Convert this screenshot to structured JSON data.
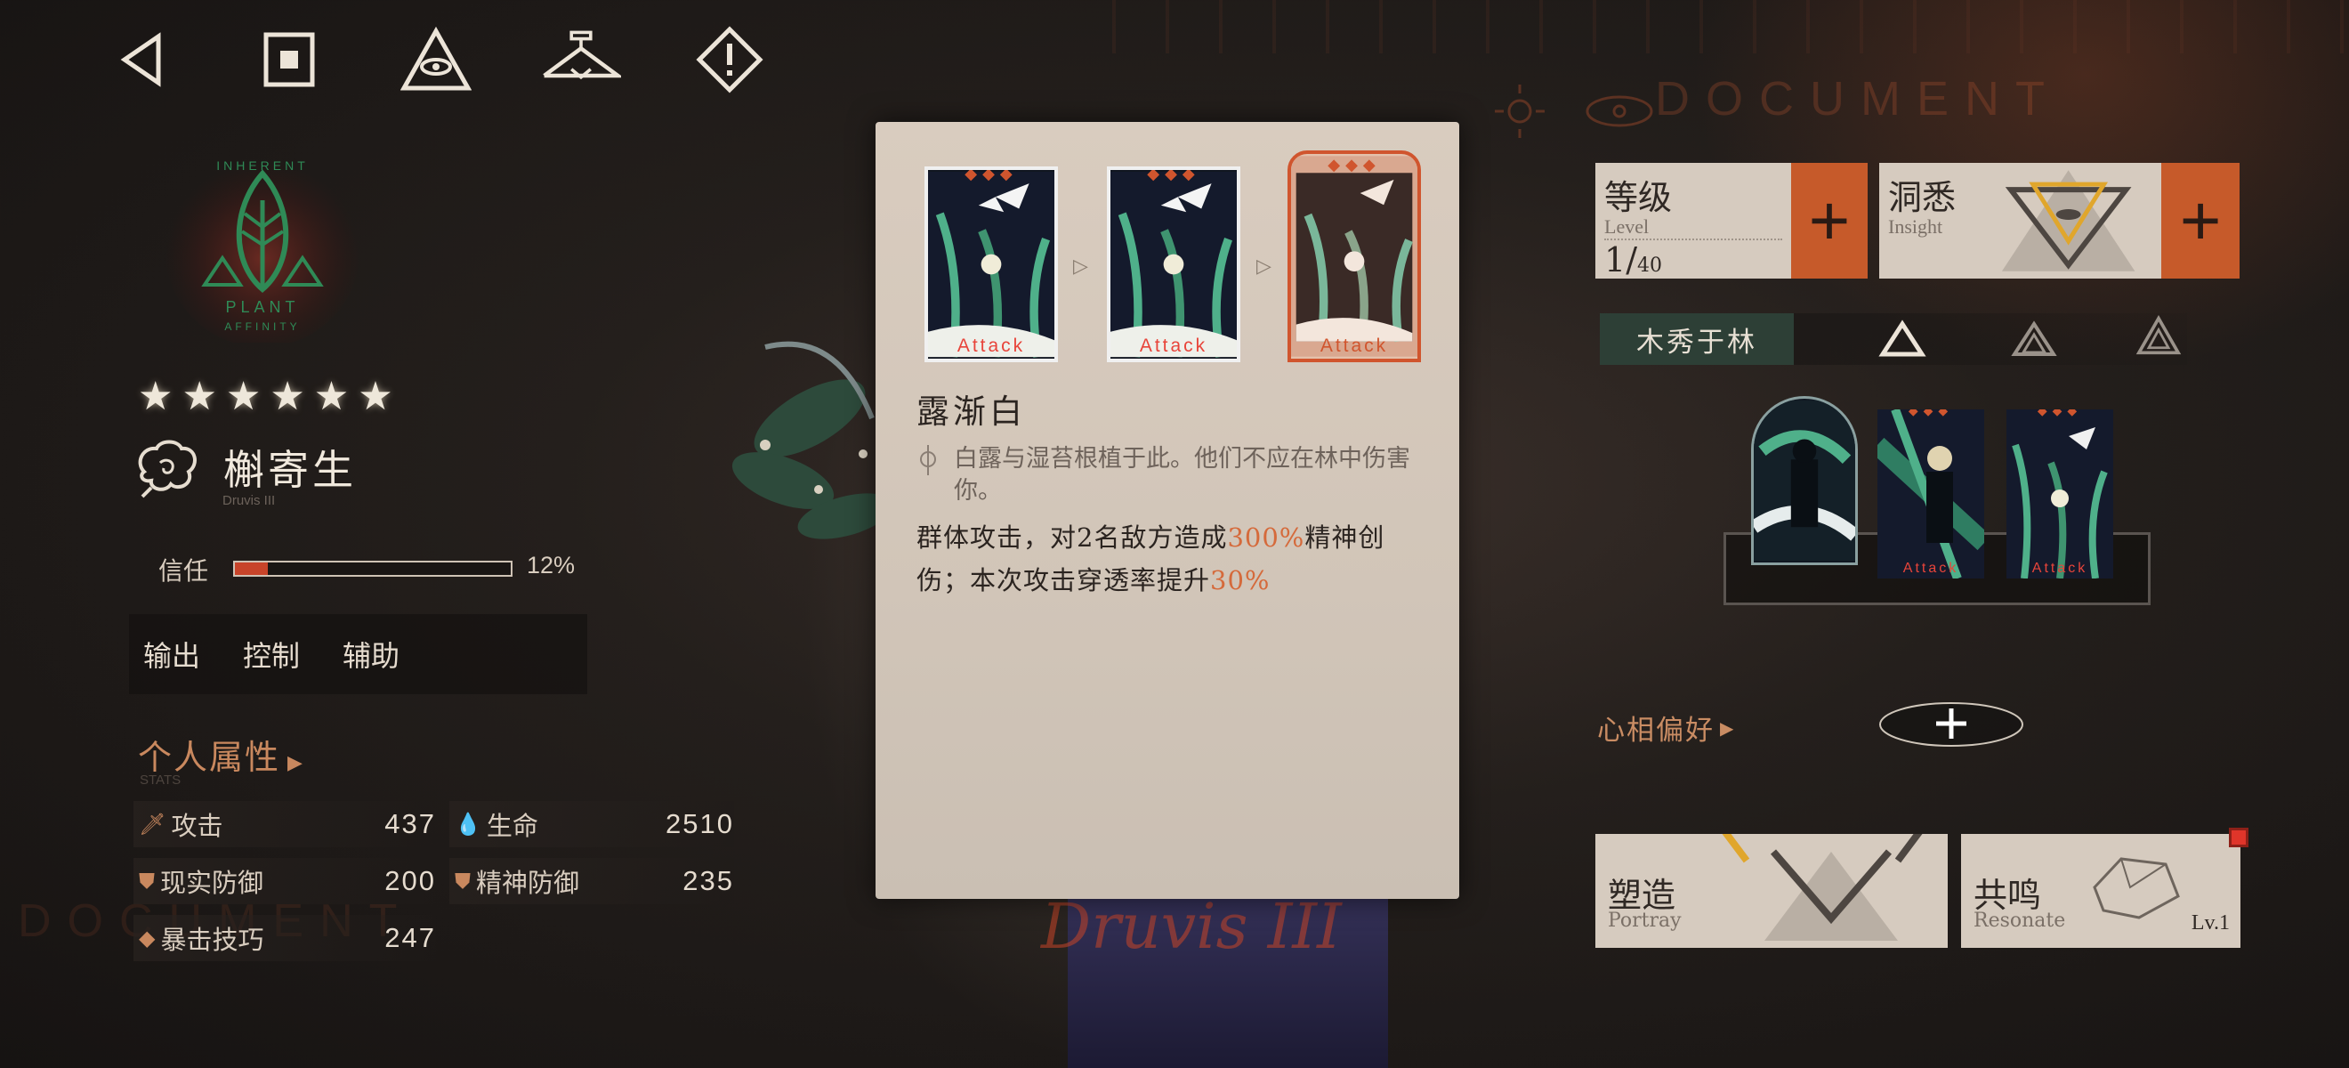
{
  "nav": {
    "back": "back-icon",
    "home": "home-icon",
    "eye": "eye-pyramid-icon",
    "wardrobe": "hanger-icon",
    "info": "info-diamond-icon"
  },
  "background": {
    "document_text": "DOCUMENT",
    "document_text_left": "DOCUMENT"
  },
  "emblem": {
    "ring_text": "INHERENT",
    "type": "PLANT",
    "ring_text_bottom": "AFFINITY"
  },
  "character": {
    "rarity": "★★★★★★",
    "rarity_count": 6,
    "name": "槲寄生",
    "name_en": "Druvis III",
    "signature": "Druvis III"
  },
  "trust": {
    "label": "信任",
    "value": "12%",
    "fraction": 0.12
  },
  "tags": [
    "输出",
    "控制",
    "辅助"
  ],
  "attributes": {
    "title": "个人属性",
    "subtitle": "STATS",
    "stats": [
      {
        "label": "攻击",
        "value": "437",
        "icon": "dagger-icon"
      },
      {
        "label": "生命",
        "value": "2510",
        "icon": "drop-icon"
      },
      {
        "label": "现实防御",
        "value": "200",
        "icon": "shield-icon"
      },
      {
        "label": "精神防御",
        "value": "235",
        "icon": "shield-icon"
      },
      {
        "label": "暴击技巧",
        "value": "247",
        "icon": "diamond-icon"
      }
    ]
  },
  "skill_modal": {
    "cards": [
      {
        "caption": "Attack",
        "rank": "◆◆◆"
      },
      {
        "caption": "Attack",
        "rank": "◆◆◆"
      },
      {
        "caption": "Attack",
        "rank": "◆◆◆",
        "selected": true
      }
    ],
    "name": "露渐白",
    "flavor": "白露与湿苔根植于此。他们不应在林中伤害你。",
    "desc_prefix": "群体攻击，对2名敌方造成",
    "desc_value1": "300%",
    "desc_middle": "精神创伤；本次攻击穿透率提升",
    "desc_value2": "30%"
  },
  "level": {
    "title": "等级",
    "title_en": "Level",
    "current": "1",
    "max": "40"
  },
  "insight": {
    "title": "洞悉",
    "title_en": "Insight"
  },
  "tree": {
    "name": "木秀于林"
  },
  "skill_cards": [
    {
      "caption": ""
    },
    {
      "caption": "Attack"
    },
    {
      "caption": "Attack"
    }
  ],
  "preference": {
    "label": "心相偏好"
  },
  "portray": {
    "title": "塑造",
    "title_en": "Portray"
  },
  "resonate": {
    "title": "共鸣",
    "title_en": "Resonate",
    "level": "Lv.1"
  },
  "colors": {
    "accent": "#c65a2a",
    "highlight": "#d56a3b",
    "panel": "#d6cbbf",
    "tree_bg": "#2d3f36"
  }
}
